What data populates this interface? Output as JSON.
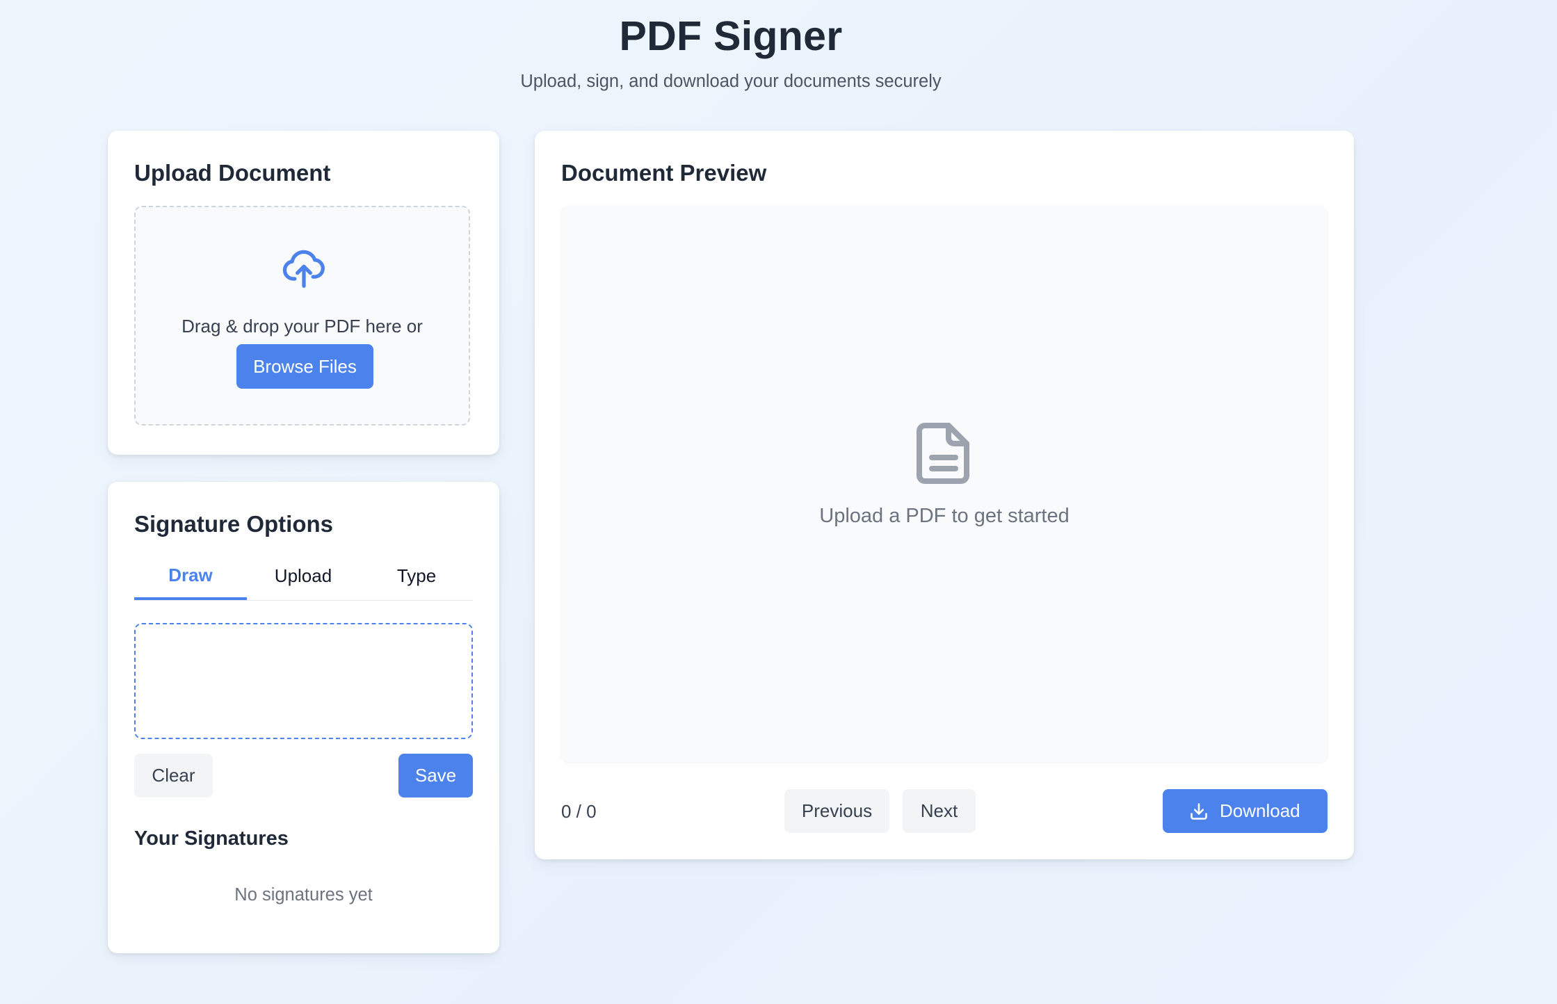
{
  "header": {
    "title": "PDF Signer",
    "subtitle": "Upload, sign, and download your documents securely"
  },
  "upload": {
    "title": "Upload Document",
    "icon": "cloud-upload-icon",
    "drop_text": "Drag & drop your PDF here or",
    "browse_label": "Browse Files"
  },
  "signature": {
    "title": "Signature Options",
    "tabs": [
      {
        "label": "Draw",
        "active": true
      },
      {
        "label": "Upload",
        "active": false
      },
      {
        "label": "Type",
        "active": false
      }
    ],
    "clear_label": "Clear",
    "save_label": "Save",
    "your_signatures_title": "Your Signatures",
    "empty_text": "No signatures yet"
  },
  "preview": {
    "title": "Document Preview",
    "icon": "document-icon",
    "empty_text": "Upload a PDF to get started",
    "page_indicator": "0 / 0",
    "previous_label": "Previous",
    "next_label": "Next",
    "download_label": "Download"
  },
  "colors": {
    "accent": "#4c82ec",
    "text_dark": "#1f2937",
    "text_muted": "#6b7280",
    "secondary_button": "#f3f4f6",
    "icon_gray": "#9ca3af"
  }
}
